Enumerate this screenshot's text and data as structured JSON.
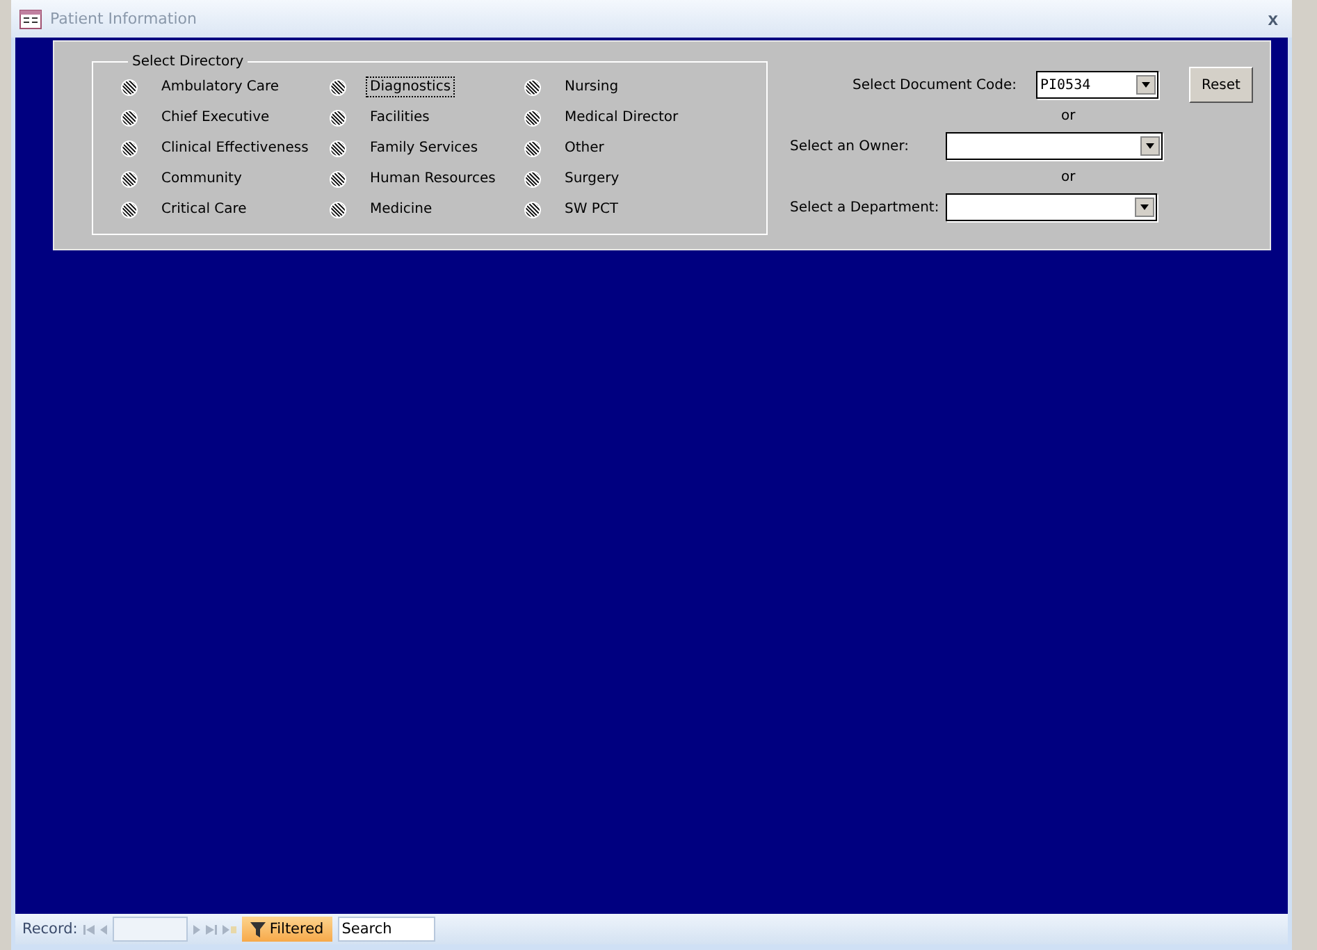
{
  "window": {
    "title": "Patient Information",
    "close": "x"
  },
  "directory": {
    "legend": "Select Directory",
    "columns": [
      [
        {
          "label": "Ambulatory Care",
          "indeterminate": true,
          "focused": false
        },
        {
          "label": "Chief Executive",
          "indeterminate": true,
          "focused": false
        },
        {
          "label": "Clinical Effectiveness",
          "indeterminate": true,
          "focused": false
        },
        {
          "label": "Community",
          "indeterminate": true,
          "focused": false
        },
        {
          "label": "Critical Care",
          "indeterminate": true,
          "focused": false
        }
      ],
      [
        {
          "label": "Diagnostics",
          "indeterminate": true,
          "focused": true
        },
        {
          "label": "Facilities",
          "indeterminate": true,
          "focused": false
        },
        {
          "label": "Family Services",
          "indeterminate": true,
          "focused": false
        },
        {
          "label": "Human Resources",
          "indeterminate": true,
          "focused": false
        },
        {
          "label": "Medicine",
          "indeterminate": true,
          "focused": false
        }
      ],
      [
        {
          "label": "Nursing",
          "indeterminate": true,
          "focused": false
        },
        {
          "label": "Medical Director",
          "indeterminate": true,
          "focused": false
        },
        {
          "label": "Other",
          "indeterminate": true,
          "focused": false
        },
        {
          "label": "Surgery",
          "indeterminate": true,
          "focused": false
        },
        {
          "label": "SW PCT",
          "indeterminate": true,
          "focused": false
        }
      ]
    ]
  },
  "filters": {
    "document_code": {
      "label": "Select Document Code:",
      "value": "PI0534"
    },
    "separator_1": "or",
    "owner": {
      "label": "Select an Owner:"
    },
    "separator_2": "or",
    "department": {
      "label": "Select a Department:"
    },
    "reset_button": "Reset"
  },
  "status_bar": {
    "record_label": "Record:",
    "nav_buttons": [
      {
        "kind": "first"
      },
      {
        "kind": "previous"
      },
      {
        "kind": "next"
      },
      {
        "kind": "last"
      },
      {
        "kind": "new"
      }
    ],
    "filter_status": "Filtered",
    "search": {
      "placeholder": "Search"
    }
  }
}
